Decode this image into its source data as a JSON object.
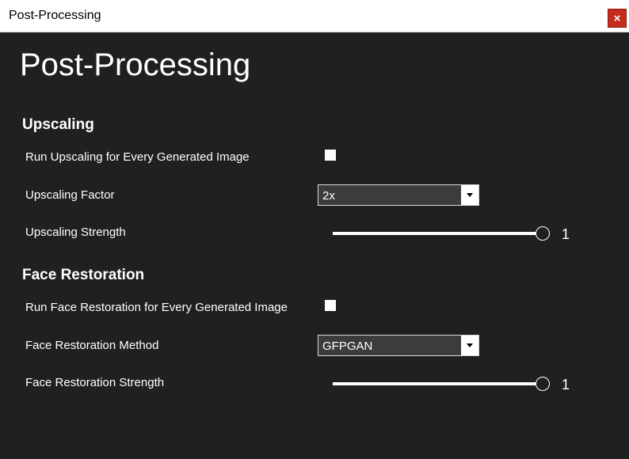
{
  "window": {
    "title": "Post-Processing",
    "close_label": "×"
  },
  "page": {
    "title": "Post-Processing"
  },
  "upscaling": {
    "section_title": "Upscaling",
    "run_label": "Run Upscaling for Every Generated Image",
    "run_checked": false,
    "factor_label": "Upscaling Factor",
    "factor_value": "2x",
    "strength_label": "Upscaling Strength",
    "strength_value": "1",
    "strength_fraction": 1.0
  },
  "face_restoration": {
    "section_title": "Face Restoration",
    "run_label": "Run Face Restoration for Every Generated Image",
    "run_checked": false,
    "method_label": "Face Restoration Method",
    "method_value": "GFPGAN",
    "strength_label": "Face Restoration Strength",
    "strength_value": "1",
    "strength_fraction": 1.0
  }
}
